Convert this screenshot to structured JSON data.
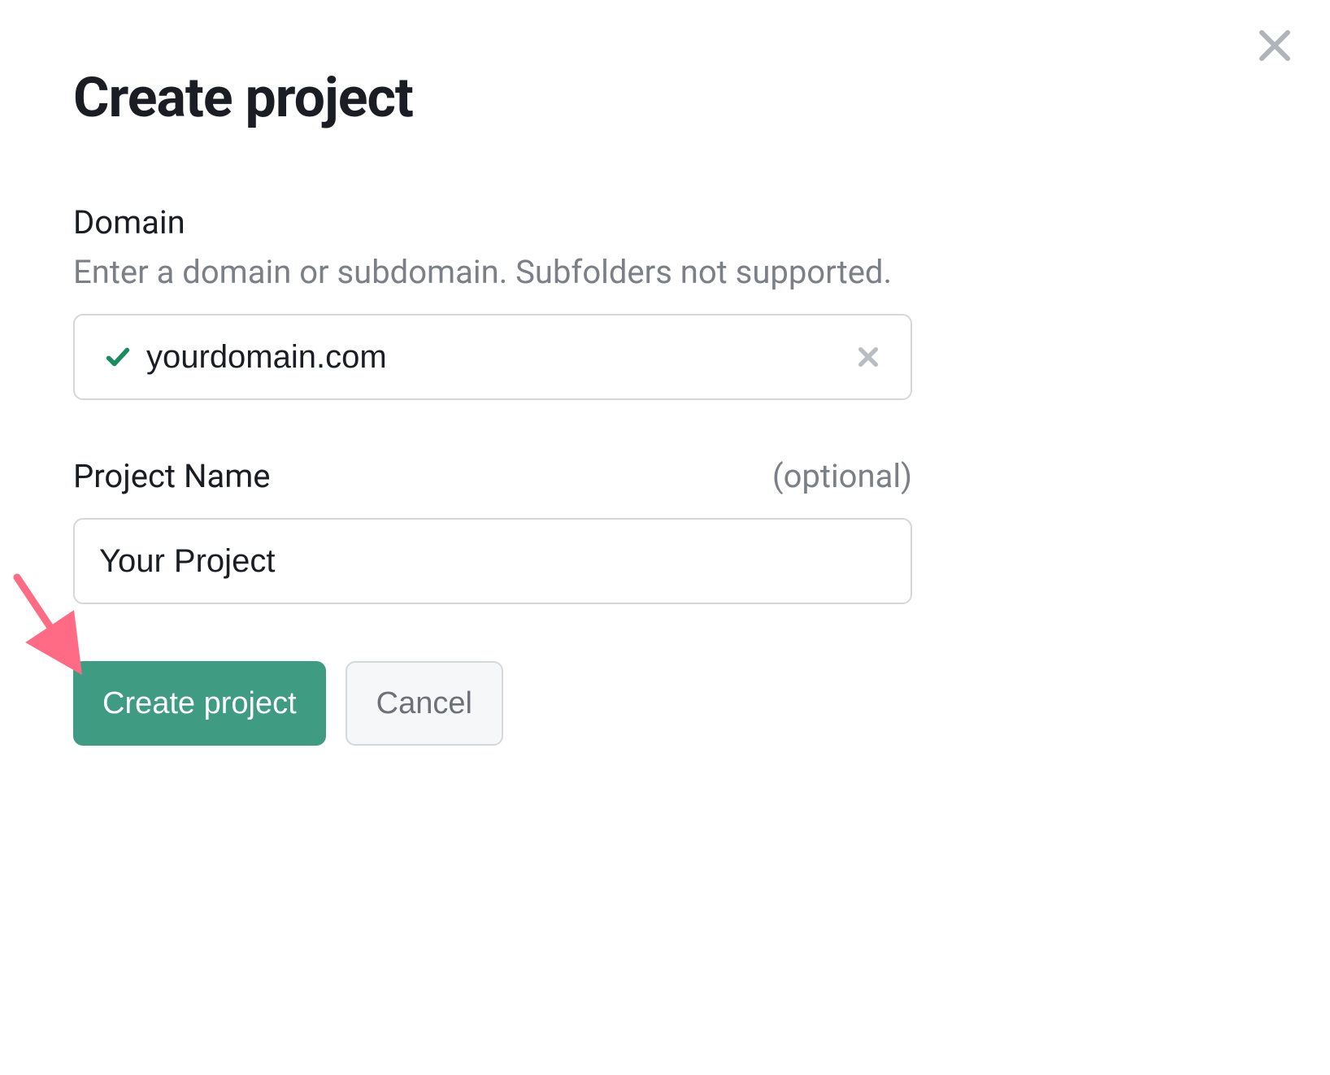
{
  "dialog": {
    "title": "Create project",
    "domain": {
      "label": "Domain",
      "help": "Enter a domain or subdomain. Subfolders not supported.",
      "value": "yourdomain.com"
    },
    "project_name": {
      "label": "Project Name",
      "optional_hint": "(optional)",
      "value": "Your Project"
    },
    "buttons": {
      "create": "Create project",
      "cancel": "Cancel"
    }
  }
}
